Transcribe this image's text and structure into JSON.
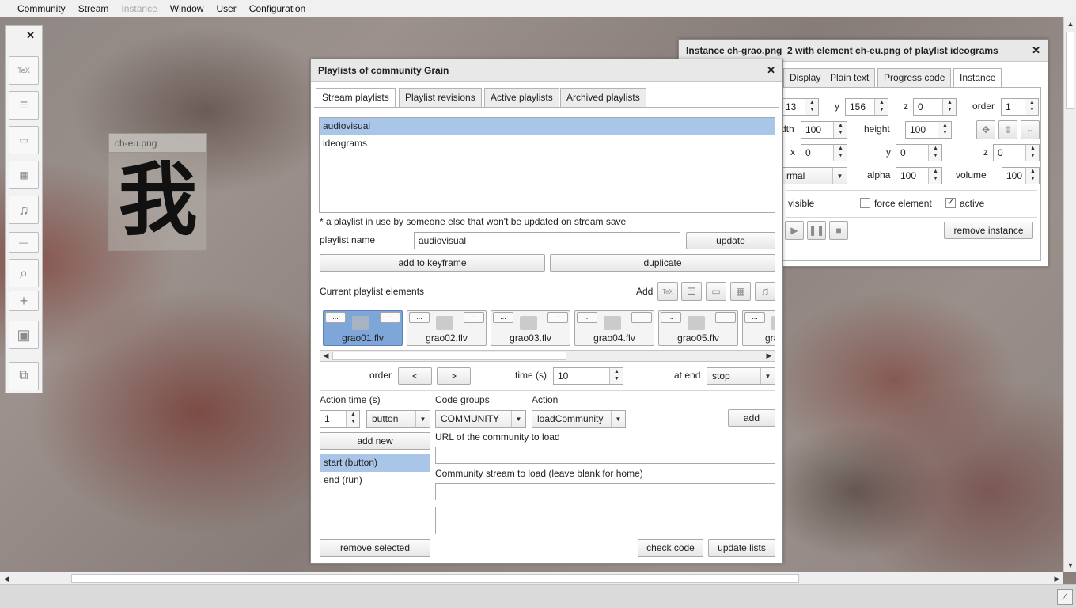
{
  "menu": {
    "items": [
      "Community",
      "Stream",
      "Instance",
      "Window",
      "User",
      "Configuration"
    ]
  },
  "tool_icons": [
    "tex-icon",
    "text-document-icon",
    "rectangle-icon",
    "video-clapper-icon",
    "music-note-icon",
    "minus-zoom-icon",
    "magnifier-icon",
    "plus-zoom-icon",
    "shape-icon",
    "windows-icon"
  ],
  "tool_glyphs": [
    "TeX",
    "☰",
    "▭",
    "▦",
    "♫",
    "—",
    "⌕",
    "+",
    "▣",
    "⧉"
  ],
  "preview": {
    "label": "ch-eu.png",
    "glyph": "我"
  },
  "instance": {
    "title": "Instance ch-grao.png_2 with element ch-eu.png of playlist ideograms",
    "tabs": [
      "Display",
      "Plain text",
      "Progress code",
      "Instance"
    ],
    "x_value": "13",
    "y_label": "y",
    "y_value": "156",
    "z_label": "z",
    "z_value": "0",
    "order_label": "order",
    "order_value": "1",
    "width_label": "dth",
    "width_value": "100",
    "height_label": "height",
    "height_value": "100",
    "x2_label": "x",
    "x2_value": "0",
    "y2_label": "y",
    "y2_value": "0",
    "z2_label": "z",
    "z2_value": "0",
    "blend_value": "rmal",
    "alpha_label": "alpha",
    "alpha_value": "100",
    "volume_label": "volume",
    "volume_value": "100",
    "visible_label": "visible",
    "force_label": "force element",
    "active_label": "active",
    "remove_label": "remove instance"
  },
  "playlists": {
    "title": "Playlists of community Grain",
    "tabs": [
      "Stream playlists",
      "Playlist revisions",
      "Active playlists",
      "Archived playlists"
    ],
    "items": [
      "audiovisual",
      "ideograms"
    ],
    "note": "* a playlist in use by someone else that won't be updated on stream save",
    "name_label": "playlist name",
    "name_value": "audiovisual",
    "update_label": "update",
    "add_keyframe_label": "add to keyframe",
    "duplicate_label": "duplicate",
    "current_label": "Current playlist elements",
    "add_label": "Add",
    "elements": [
      {
        "name": "grao01.flv",
        "dots": "...",
        "minus": "-"
      },
      {
        "name": "grao02.flv",
        "dots": "...",
        "minus": "-"
      },
      {
        "name": "grao03.flv",
        "dots": "...",
        "minus": "-"
      },
      {
        "name": "grao04.flv",
        "dots": "...",
        "minus": "-"
      },
      {
        "name": "grao05.flv",
        "dots": "...",
        "minus": "-"
      },
      {
        "name": "gra",
        "dots": "...",
        "minus": ""
      }
    ],
    "order_label": "order",
    "prev_label": "<",
    "next_label": ">",
    "time_label": "time (s)",
    "time_value": "10",
    "at_end_label": "at end",
    "at_end_value": "stop",
    "action_time_label": "Action time (s)",
    "action_time_value": "1",
    "trigger_value": "button",
    "code_groups_label": "Code groups",
    "code_groups_value": "COMMUNITY",
    "action_label": "Action",
    "action_value": "loadCommunity",
    "add_btn": "add",
    "add_new_label": "add new",
    "actions": [
      "start (button)",
      "end (run)"
    ],
    "url_label": "URL of the community to load",
    "stream_label": "Community stream to load (leave blank for home)",
    "remove_selected": "remove selected",
    "check_code": "check code",
    "update_lists": "update lists"
  },
  "colors": {
    "selection": "#a9c6e8",
    "active_element": "#7fa6d8"
  }
}
